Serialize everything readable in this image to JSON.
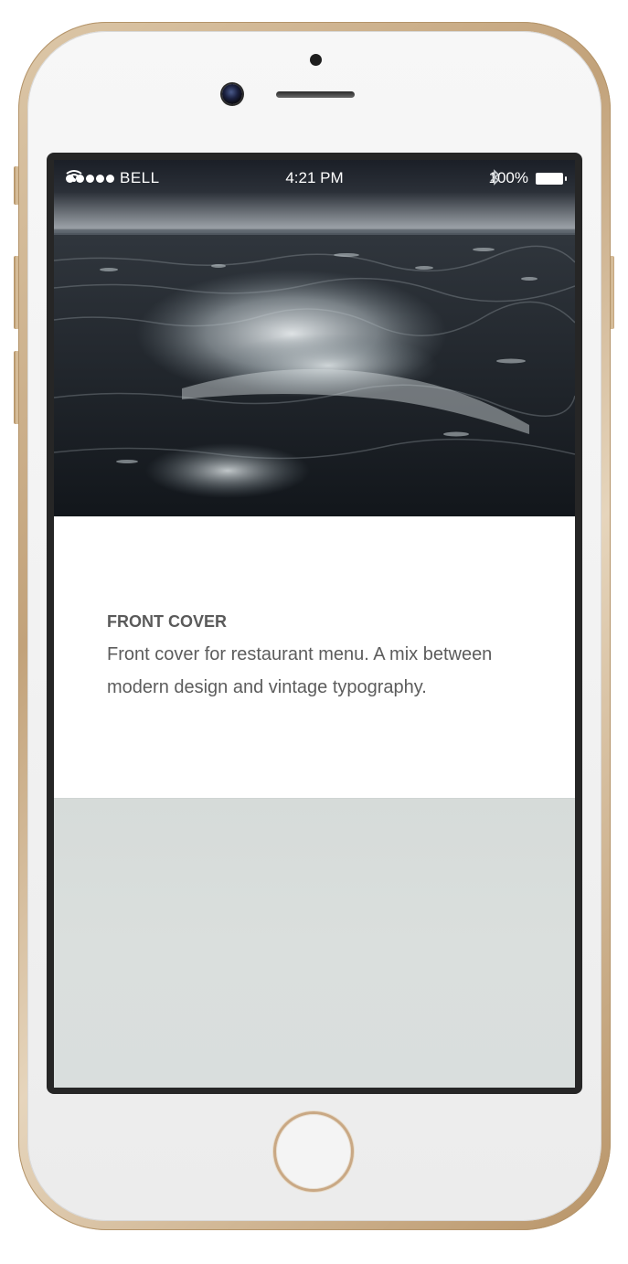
{
  "status_bar": {
    "carrier": "BELL",
    "time": "4:21 PM",
    "battery": "100%"
  },
  "article": {
    "title": "FRONT COVER",
    "description": "Front cover for restaurant menu. A mix between modern design and vintage typography."
  },
  "icons": {
    "signal": "signal-dots-icon",
    "wifi": "wifi-icon",
    "bluetooth": "bluetooth-icon",
    "battery": "battery-icon"
  },
  "colors": {
    "frame_gold": "#c8a97f",
    "text_gray": "#5c5c5c",
    "lower_panel": "#d8dddb",
    "bezel": "#262626"
  }
}
